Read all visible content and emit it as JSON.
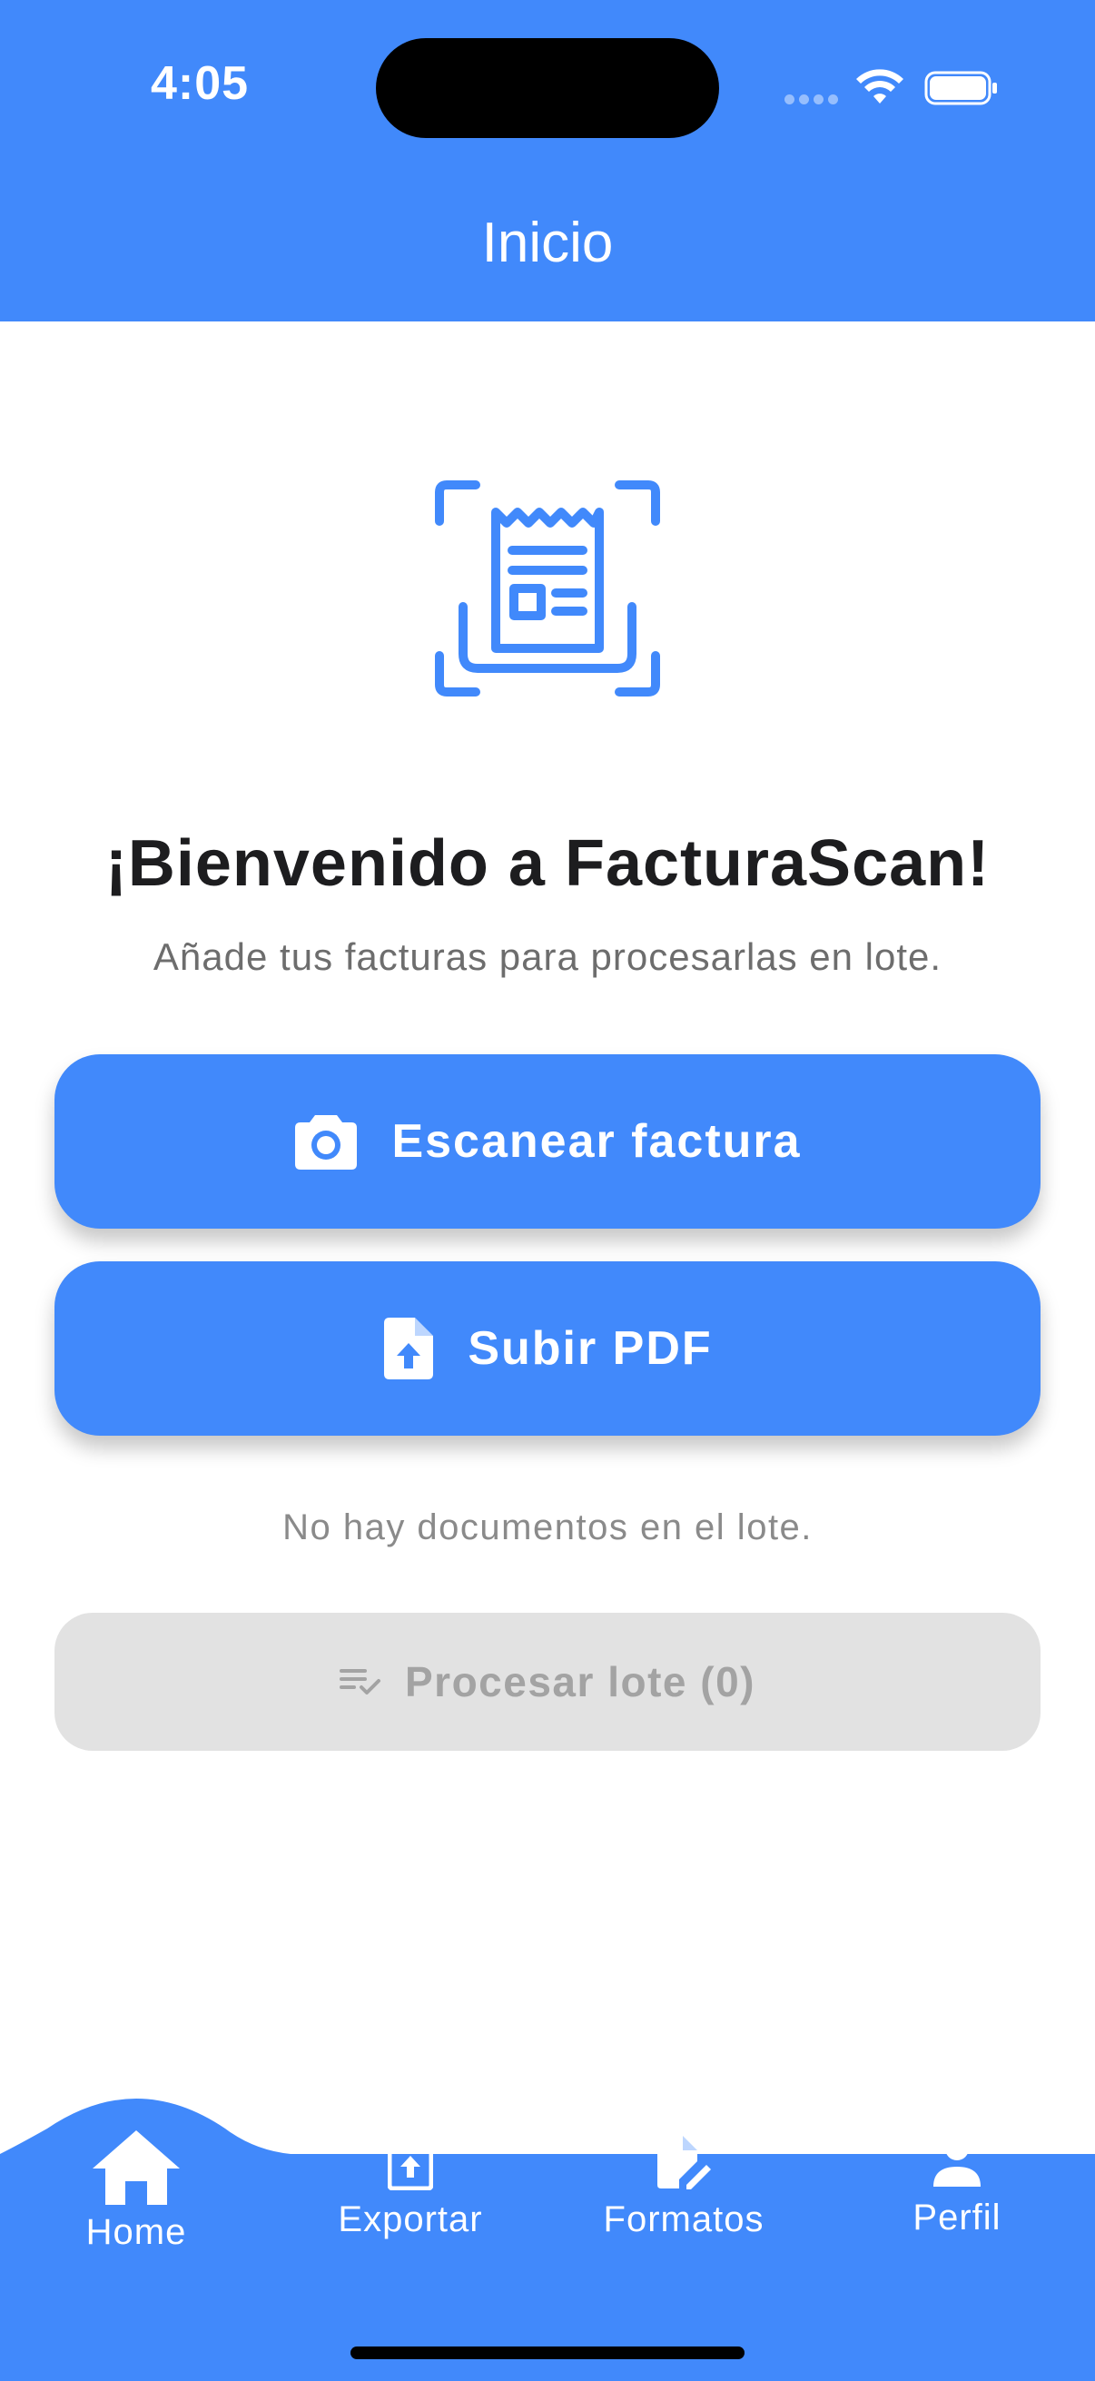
{
  "status_bar": {
    "time": "4:05"
  },
  "header": {
    "title": "Inicio"
  },
  "hero": {
    "icon": "receipt-scan-icon"
  },
  "welcome": {
    "title": "¡Bienvenido a FacturaScan!",
    "subtitle": "Añade tus facturas para procesarlas en lote."
  },
  "actions": {
    "scan_label": "Escanear factura",
    "pdf_label": "Subir PDF"
  },
  "batch": {
    "empty_message": "No hay documentos en el lote.",
    "process_label": "Procesar lote (0)"
  },
  "bottom_nav": {
    "items": [
      {
        "label": "Home",
        "icon": "home-icon",
        "active": true
      },
      {
        "label": "Exportar",
        "icon": "file-upload-icon",
        "active": false
      },
      {
        "label": "Formatos",
        "icon": "file-edit-icon",
        "active": false
      },
      {
        "label": "Perfil",
        "icon": "person-icon",
        "active": false
      }
    ]
  },
  "colors": {
    "primary": "#4189fb",
    "disabled_bg": "#e2e2e2",
    "disabled_text": "#a3a3a3"
  }
}
